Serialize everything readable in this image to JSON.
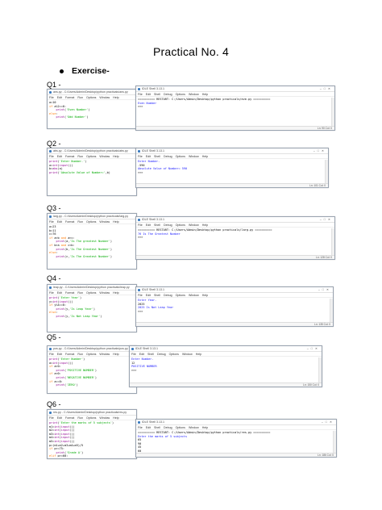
{
  "title": "Practical No. 4",
  "section": "Exercise-",
  "menus": {
    "editor": [
      "File",
      "Edit",
      "Format",
      "Run",
      "Options",
      "Window",
      "Help"
    ],
    "shell": [
      "File",
      "Edit",
      "Shell",
      "Debug",
      "Options",
      "Window",
      "Help"
    ]
  },
  "questions": [
    {
      "label": "Q1 -",
      "editor_title": "ans.py - C:/Users/Admin/Desktop/python practicals/ans.py",
      "editor_code": [
        "a=10",
        "if a%2==0:",
        "    print('Even Number')",
        "else:",
        "    print('Odd Number')"
      ],
      "shell_title": "IDLE Shell 3.13.1",
      "shell_lines": [
        "========== RESTART: C:/Users/Admin/Desktop/python practicals/eve.py ==========",
        "Even Number",
        ">>>"
      ],
      "shell_status": "Ln: 90   Col: 0"
    },
    {
      "label": "Q2 -",
      "editor_title": "abs.py - C:/Users/Admin/Desktop/python practicals/abs.py",
      "editor_code": [
        "print('Enter Number-')",
        "a=int(input())",
        "b=abs(a)",
        "print('Absolute Value of Number=',b)"
      ],
      "shell_title": "IDLE Shell 3.13.1",
      "shell_lines": [
        "Enter Number-",
        "-590",
        "Absolute Value of Number= 590",
        ">>>"
      ],
      "shell_status": "Ln: 101   Col: 0"
    },
    {
      "label": "Q3 -",
      "editor_title": "larg.py - C:/Users/Admin/Desktop/python practicals/larg.py",
      "editor_code": [
        "a=23",
        "b=11",
        "c=76",
        "if a>b and a>c:",
        "    print(a,'Is The greatest Number')",
        "if b>a and c<b:",
        "    print(b,'Is The Greatest Number')",
        "else:",
        "    print(c,'Is The Greatest Number')"
      ],
      "shell_title": "IDLE Shell 3.13.1",
      "shell_lines": [
        "========== RESTART: C:/Users/Admin/Desktop/python practicals/larg.py ==========",
        "76 Is The Greatest Number",
        ">>>"
      ],
      "shell_status": "Ln: 128   Col: 0"
    },
    {
      "label": "Q4 -",
      "editor_title": "leap.py - C:/Users/Admin/Desktop/python practicals/leap.py",
      "editor_code": [
        "print('Enter Year')",
        "y=int(input())",
        "if y%4==0:",
        "    print(y,'Is Leap Year')",
        "else:",
        "    print(y,'Is Not Leap Year')"
      ],
      "shell_title": "IDLE Shell 3.13.1",
      "shell_lines": [
        "Enter Year-",
        "2025",
        "2025 Is Not Leap Year",
        ">>>"
      ],
      "shell_status": "Ln: 135   Col: 0"
    },
    {
      "label": "Q5 -",
      "editor_title": "pos.py - C:/Users/Admin/Desktop/python practicals/pos.py",
      "editor_code": [
        "print('Enter Number')",
        "a=int(input())",
        "if a>0:",
        "    print('POSITIVE NUMBER')",
        "if a<0:",
        "    print('NEGATIVE NUMBER')",
        "if a==0:",
        "    print('ZERO')"
      ],
      "shell_title": "IDLE Shell 3.13.1",
      "shell_lines": [
        "Enter Number-",
        "12",
        "POSITIVE NUMBER",
        ">>>"
      ],
      "shell_status": "Ln: 150   Col: 0"
    },
    {
      "label": "Q6 -",
      "editor_title": "res.py - C:/Users/Admin/Desktop/python practicals/res.py",
      "editor_code": [
        "print('Enter the marks of 5 subjects')",
        "m1=int(input())",
        "m2=int(input())",
        "m3=int(input())",
        "m4=int(input())",
        "m5=int(input())",
        "p=(m1+m2+m3+m4+m5)/5",
        "if p>=75:",
        "    print('Grade A')",
        "elif p>=60:",
        "    print('Grade B')",
        "else:",
        "    print('Grade C')"
      ],
      "shell_title": "IDLE Shell 3.13.1",
      "shell_lines": [
        "========== RESTART: C:/Users/Admin/Desktop/python practicals/res.py ==========",
        "Enter the marks of 5 subjects",
        "65",
        "90",
        "45",
        "60",
        "85",
        "Grade B",
        ">>>"
      ],
      "shell_status": "Ln: 186   Col: 0"
    }
  ]
}
